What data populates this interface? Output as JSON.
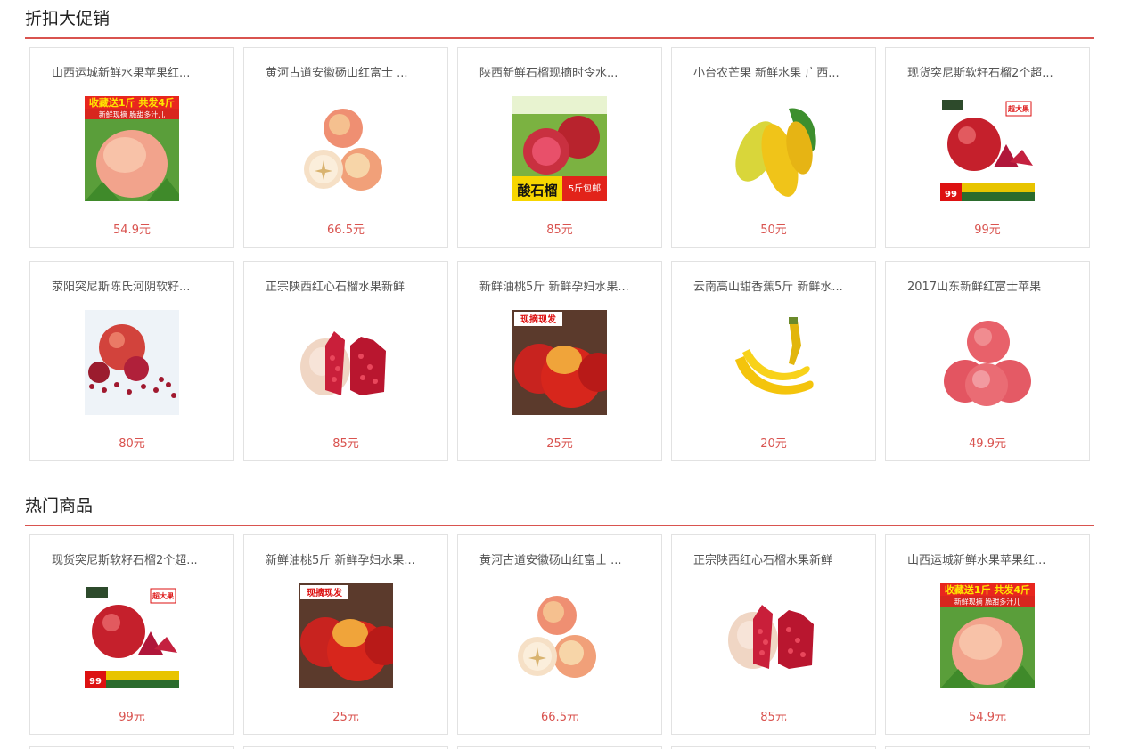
{
  "sections": [
    {
      "title": "折扣大促销",
      "products": [
        {
          "name": "山西运城新鲜水果苹果红...",
          "price": "54.9元",
          "image": "peach-banner"
        },
        {
          "name": "黄河古道安徽砀山红富士 ...",
          "price": "66.5元",
          "image": "apples"
        },
        {
          "name": "陕西新鲜石榴现摘时令水...",
          "price": "85元",
          "image": "pomegranate-banner"
        },
        {
          "name": "小台农芒果 新鲜水果 广西...",
          "price": "50元",
          "image": "mango"
        },
        {
          "name": "现货突尼斯软籽石榴2个超...",
          "price": "99元",
          "image": "pomegranate-promo"
        },
        {
          "name": "荥阳突尼斯陈氏河阴软籽...",
          "price": "80元",
          "image": "pomegranate-seeds"
        },
        {
          "name": "正宗陕西红心石榴水果新鲜",
          "price": "85元",
          "image": "pomegranate-open"
        },
        {
          "name": "新鲜油桃5斤 新鲜孕妇水果...",
          "price": "25元",
          "image": "nectarine"
        },
        {
          "name": "云南高山甜香蕉5斤 新鲜水...",
          "price": "20元",
          "image": "banana"
        },
        {
          "name": "2017山东新鲜红富士苹果",
          "price": "49.9元",
          "image": "red-apples"
        }
      ]
    },
    {
      "title": "热门商品",
      "products": [
        {
          "name": "现货突尼斯软籽石榴2个超...",
          "price": "99元",
          "image": "pomegranate-promo"
        },
        {
          "name": "新鲜油桃5斤 新鲜孕妇水果...",
          "price": "25元",
          "image": "nectarine"
        },
        {
          "name": "黄河古道安徽砀山红富士 ...",
          "price": "66.5元",
          "image": "apples"
        },
        {
          "name": "正宗陕西红心石榴水果新鲜",
          "price": "85元",
          "image": "pomegranate-open"
        },
        {
          "name": "山西运城新鲜水果苹果红...",
          "price": "54.9元",
          "image": "peach-banner"
        }
      ]
    }
  ],
  "image_text": {
    "peach_banner_top": "收藏送1斤 共发4斤",
    "peach_banner_sub": "新鲜现摘 脆甜多汁儿",
    "pomegranate_label": "酸石榴",
    "pomegranate_tag": "5斤包邮",
    "promo_badge": "超大果",
    "promo_price": "99",
    "nectarine_tag": "现摘现发"
  },
  "colors": {
    "accent": "#d9534f",
    "price": "#d9534f",
    "border": "#e2e2e2"
  }
}
